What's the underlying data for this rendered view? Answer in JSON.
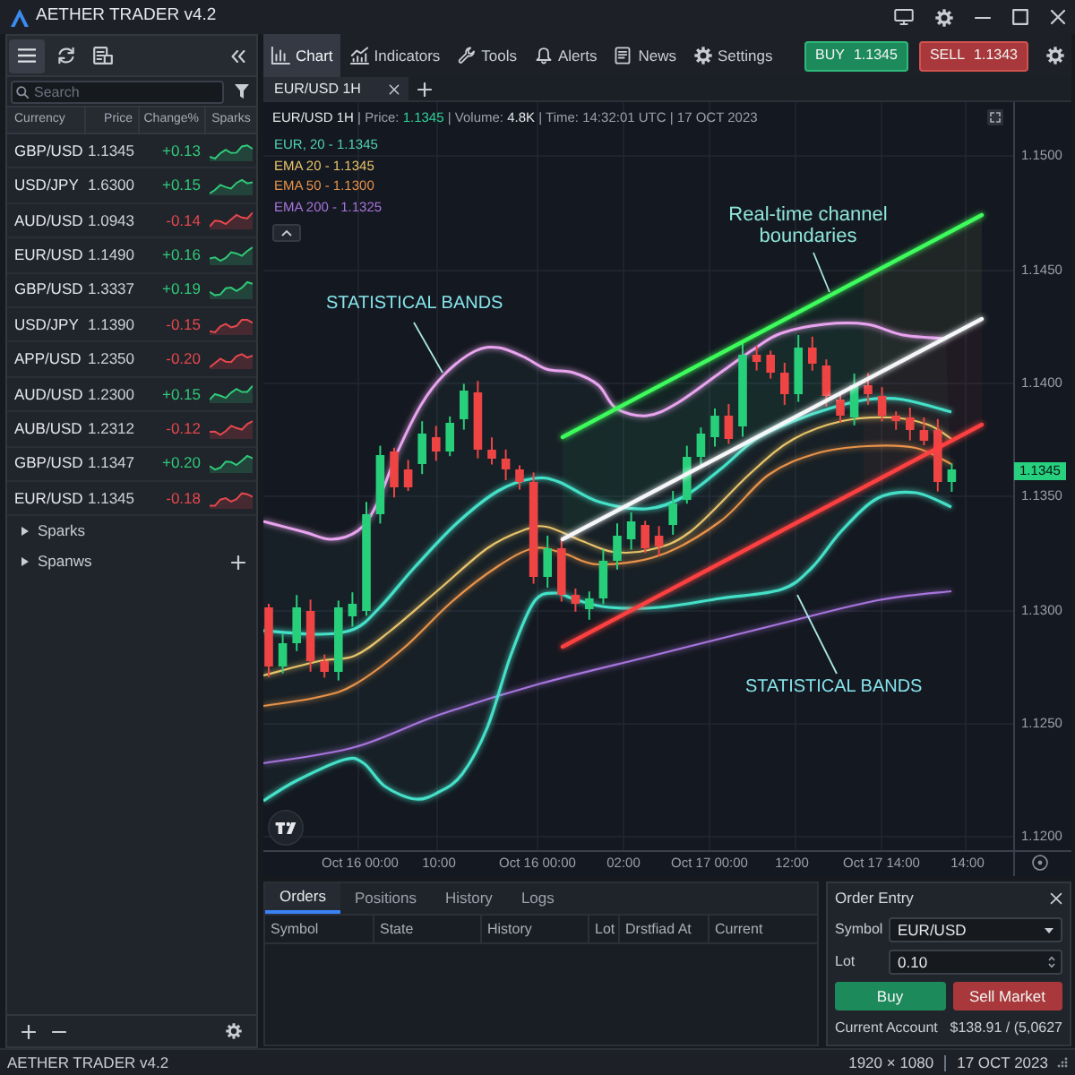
{
  "window": {
    "title": "AETHER TRADER v4.2"
  },
  "menu": {
    "tabs": [
      {
        "label": "Chart",
        "selected": true
      },
      {
        "label": "Indicators",
        "selected": false
      },
      {
        "label": "Tools",
        "selected": false
      },
      {
        "label": "Alerts",
        "selected": false
      },
      {
        "label": "News",
        "selected": false
      },
      {
        "label": "Settings",
        "selected": false
      }
    ],
    "quotes": [
      {
        "kind": "buy",
        "label": "BUY",
        "price": "1.1345"
      },
      {
        "kind": "sell",
        "label": "SELL",
        "price": "1.1343"
      }
    ]
  },
  "watchlist": {
    "search": {
      "placeholder": "Search"
    },
    "columns": [
      "Currency",
      "Price",
      "Change%",
      "Sparks"
    ],
    "rows": [
      {
        "currency": "GBP/USD",
        "price": "1.1345",
        "change": "+0.13",
        "rising": true
      },
      {
        "currency": "USD/JPY",
        "price": "1.6300",
        "change": "+0.15",
        "rising": true
      },
      {
        "currency": "AUD/USD",
        "price": "1.0943",
        "change": "-0.14",
        "rising": false
      },
      {
        "currency": "EUR/USD",
        "price": "1.1490",
        "change": "+0.16",
        "rising": true
      },
      {
        "currency": "GBP/USD",
        "price": "1.3337",
        "change": "+0.19",
        "rising": true
      },
      {
        "currency": "USD/JPY",
        "price": "1.1390",
        "change": "-0.15",
        "rising": false
      },
      {
        "currency": "APP/USD",
        "price": "1.2350",
        "change": "-0.20",
        "rising": false
      },
      {
        "currency": "AUD/USD",
        "price": "1.2300",
        "change": "+0.15",
        "rising": true
      },
      {
        "currency": "AUB/USD",
        "price": "1.2312",
        "change": "-0.12",
        "rising": false
      },
      {
        "currency": "GBP/USD",
        "price": "1.1347",
        "change": "+0.20",
        "rising": true
      },
      {
        "currency": "EUR/USD",
        "price": "1.1345",
        "change": "-0.18",
        "rising": false
      }
    ],
    "groups": [
      {
        "label": "Sparks",
        "expanded": false
      },
      {
        "label": "Spanws",
        "expanded": false
      }
    ]
  },
  "chart": {
    "tab": "EUR/USD 1H",
    "info": [
      {
        "text": "EUR/USD 1H",
        "kind": "value"
      },
      {
        "text": "| Price:",
        "kind": "label"
      },
      {
        "text": "1.1345",
        "kind": "up"
      },
      {
        "text": "| Volume:",
        "kind": "label"
      },
      {
        "text": "4.8K",
        "kind": "value"
      },
      {
        "text": "| Time: 14:32:01 UTC | 17 OCT 2023",
        "kind": "label"
      }
    ],
    "legend": [
      {
        "label": "EUR, 20 - 1.1345",
        "color": "#4fd1b5"
      },
      {
        "label": "EMA 20 - 1.1345",
        "color": "#e9c46a"
      },
      {
        "label": "EMA 50 - 1.1300",
        "color": "#e8934a"
      },
      {
        "label": "EMA 200 - 1.1325",
        "color": "#a774dd"
      }
    ],
    "annotations": [
      {
        "text": "Real-time channel boundaries"
      },
      {
        "text": "STATISTICAL BANDS"
      },
      {
        "text": "STATISTICAL BANDS"
      }
    ],
    "price_labels": [
      "1.1500",
      "1.1450",
      "1.1400",
      "1.1350",
      "1.1300",
      "1.1250",
      "1.1200"
    ],
    "current_price": "1.1345",
    "time_labels": [
      "Oct 16 00:00",
      "10:00",
      "Oct 16 00:00",
      "02:00",
      "Oct 17 00:00",
      "12:00",
      "Oct 17 14:00",
      "14:00"
    ]
  },
  "orders": {
    "tabs": [
      {
        "label": "Orders",
        "selected": true
      },
      {
        "label": "Positions",
        "selected": false
      },
      {
        "label": "History",
        "selected": false
      },
      {
        "label": "Logs",
        "selected": false
      }
    ],
    "columns": [
      "Symbol",
      "State",
      "History",
      "Lot",
      "Drstfiad At",
      "Current"
    ]
  },
  "order_entry": {
    "title": "Order Entry",
    "fields": [
      {
        "kind": "select",
        "label": "Symbol",
        "value": "EUR/USD"
      },
      {
        "kind": "number",
        "label": "Lot",
        "value": "0.10"
      }
    ],
    "buttons": [
      {
        "kind": "buy",
        "label": "Buy"
      },
      {
        "kind": "sell",
        "label": "Sell Market"
      }
    ],
    "account": {
      "label": "Current Account",
      "value": "$138.91 / (5,0627"
    }
  },
  "status_bar": {
    "app": "AETHER TRADER v4.2",
    "resolution": "1920 × 1080",
    "date": "17 OCT 2023"
  }
}
